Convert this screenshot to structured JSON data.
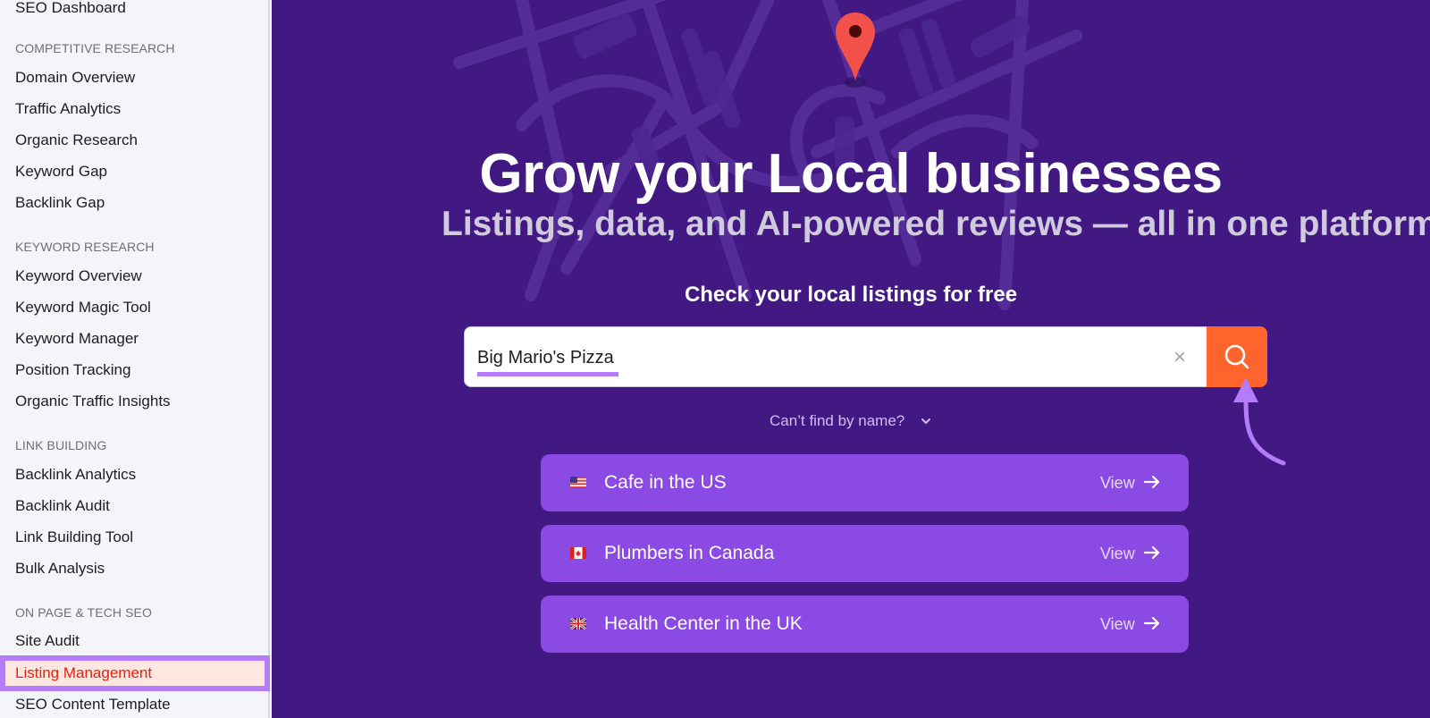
{
  "sidebar": {
    "top_item": "SEO Dashboard",
    "sections": [
      {
        "heading": "COMPETITIVE RESEARCH",
        "items": [
          "Domain Overview",
          "Traffic Analytics",
          "Organic Research",
          "Keyword Gap",
          "Backlink Gap"
        ]
      },
      {
        "heading": "KEYWORD RESEARCH",
        "items": [
          "Keyword Overview",
          "Keyword Magic Tool",
          "Keyword Manager",
          "Position Tracking",
          "Organic Traffic Insights"
        ]
      },
      {
        "heading": "LINK BUILDING",
        "items": [
          "Backlink Analytics",
          "Backlink Audit",
          "Link Building Tool",
          "Bulk Analysis"
        ]
      },
      {
        "heading": "ON PAGE & TECH SEO",
        "items": [
          "Site Audit",
          "Listing Management",
          "SEO Content Template"
        ]
      }
    ],
    "active_item": "Listing Management"
  },
  "hero": {
    "title": "Grow your Local businesses",
    "subtitle": "Listings, data, and AI-powered reviews — all in one platform.",
    "check_label": "Check your local listings for free",
    "search": {
      "value": "Big Mario's Pizza",
      "clear_icon": "×"
    },
    "cant_find": "Can’t find by name?",
    "examples": [
      {
        "label": "Cafe in the US",
        "flag": "us-flag-icon",
        "view": "View"
      },
      {
        "label": "Plumbers in Canada",
        "flag": "canada-flag-icon",
        "view": "View"
      },
      {
        "label": "Health Center in the UK",
        "flag": "uk-flag-icon",
        "view": "View"
      }
    ]
  },
  "colors": {
    "hero_bg": "#421983",
    "accent_orange": "#ff642d",
    "highlight_purple": "#b57cf9",
    "example_card": "#8a4ae3",
    "active_text": "#e5220f",
    "active_bg": "#ffe7e1"
  }
}
